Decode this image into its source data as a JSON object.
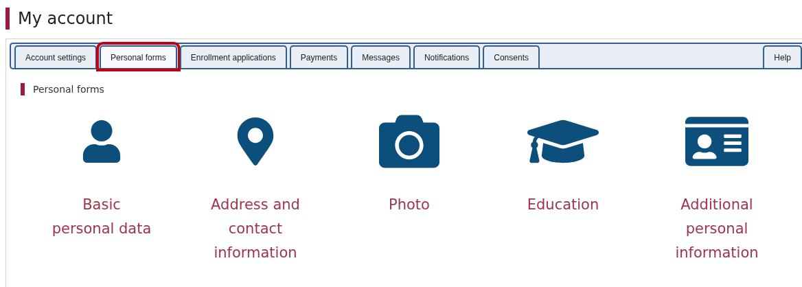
{
  "page_title": "My account",
  "tabs": [
    {
      "label": "Account settings",
      "selected": false
    },
    {
      "label": "Personal forms",
      "selected": true
    },
    {
      "label": "Enrollment applications",
      "selected": false
    },
    {
      "label": "Payments",
      "selected": false
    },
    {
      "label": "Messages",
      "selected": false
    },
    {
      "label": "Notifications",
      "selected": false
    },
    {
      "label": "Consents",
      "selected": false
    }
  ],
  "help_tab": {
    "label": "Help",
    "selected": false
  },
  "section_title": "Personal forms",
  "forms": [
    {
      "kind": "person",
      "label": "Basic personal data"
    },
    {
      "kind": "location",
      "label": "Address and contact information"
    },
    {
      "kind": "camera",
      "label": "Photo"
    },
    {
      "kind": "education",
      "label": "Education"
    },
    {
      "kind": "idcard",
      "label": "Additional personal information"
    }
  ]
}
